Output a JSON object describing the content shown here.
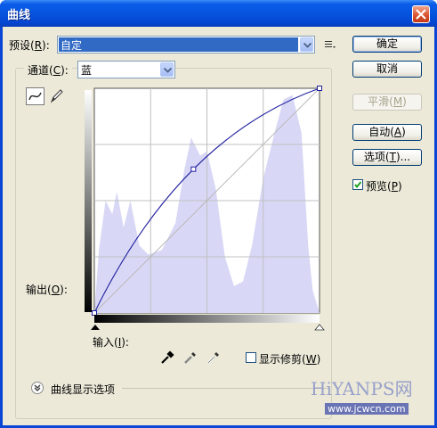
{
  "window": {
    "title": "曲线"
  },
  "preset": {
    "label": "预设(",
    "key": "R",
    "suffix": "):",
    "value": "自定"
  },
  "channel": {
    "label": "通道(",
    "key": "C",
    "suffix": "):",
    "value": "蓝"
  },
  "buttons": {
    "ok": "确定",
    "cancel": "取消",
    "smooth": {
      "text": "平滑(",
      "key": "M",
      "suffix": ")"
    },
    "auto": {
      "text": "自动(",
      "key": "A",
      "suffix": ")"
    },
    "options": {
      "text": "选项(",
      "key": "T",
      "suffix": ")..."
    }
  },
  "preview": {
    "text": "预览(",
    "key": "P",
    "suffix": ")",
    "checked": true
  },
  "graph": {
    "output_label": {
      "text": "输出(",
      "key": "O",
      "suffix": "):"
    },
    "input_label": {
      "text": "输入(",
      "key": "I",
      "suffix": "):"
    },
    "curve_points": [
      [
        0,
        0
      ],
      [
        0.44,
        0.64
      ],
      [
        1,
        1
      ]
    ]
  },
  "show_clipping": {
    "text": "显示修剪(",
    "key": "W",
    "suffix": ")",
    "checked": false
  },
  "curve_display_options": "曲线显示选项",
  "watermark": {
    "brand": "HiYANPS网",
    "url": "www.jcwcn.com"
  },
  "colors": {
    "title_bar": "#0655df",
    "histogram": "#d8d8f6",
    "curve": "#2020a0",
    "dialog": "#ece9d8"
  }
}
